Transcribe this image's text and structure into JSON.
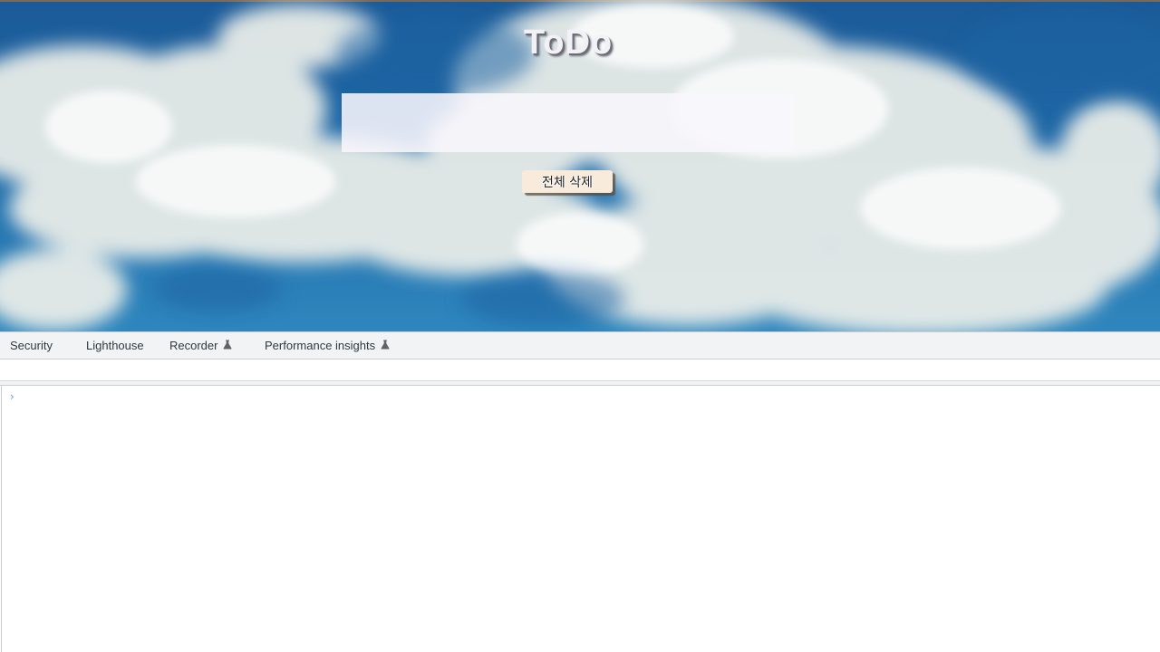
{
  "app": {
    "title": "ToDo",
    "input": {
      "value": "",
      "placeholder": ""
    },
    "clear_all_label": "전체 삭제"
  },
  "devtools": {
    "tabs": [
      {
        "label": "Security",
        "experimental": false
      },
      {
        "label": "Lighthouse",
        "experimental": false
      },
      {
        "label": "Recorder",
        "experimental": true,
        "icon": "flask-icon"
      },
      {
        "label": "Performance insights",
        "experimental": true,
        "icon": "flask-icon"
      }
    ],
    "console": {
      "prompt_icon": "chevron-right-icon",
      "value": ""
    }
  },
  "colors": {
    "sky_blue": "#1f6aa8",
    "button_bg": "#f8ebdc",
    "devtools_bg": "#f1f3f4"
  }
}
